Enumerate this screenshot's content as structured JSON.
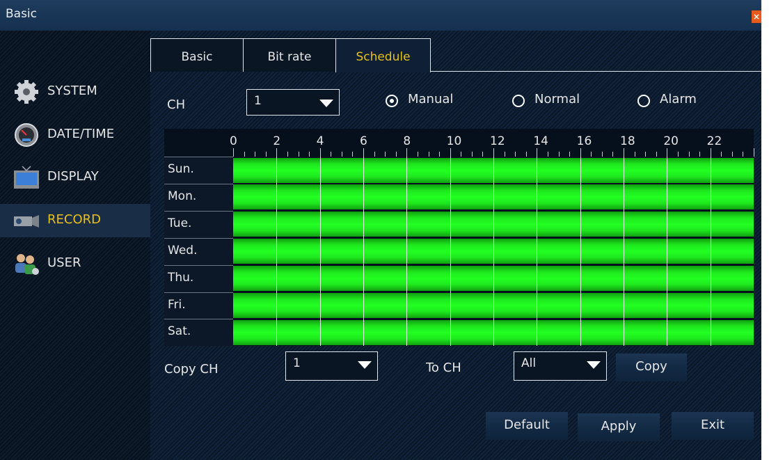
{
  "window": {
    "title": "Basic",
    "close_icon": "×"
  },
  "sidebar": {
    "items": [
      {
        "label": "SYSTEM",
        "icon": "gear-icon",
        "active": false
      },
      {
        "label": "DATE/TIME",
        "icon": "gauge-icon",
        "active": false
      },
      {
        "label": "DISPLAY",
        "icon": "monitor-icon",
        "active": false
      },
      {
        "label": "RECORD",
        "icon": "camera-icon",
        "active": true
      },
      {
        "label": "USER",
        "icon": "users-icon",
        "active": false
      }
    ]
  },
  "tabs": [
    {
      "label": "Basic"
    },
    {
      "label": "Bit rate"
    },
    {
      "label": "Schedule",
      "active": true
    }
  ],
  "channel": {
    "label": "CH",
    "value": "1"
  },
  "record_modes": [
    {
      "label": "Manual",
      "selected": true
    },
    {
      "label": "Normal",
      "selected": false
    },
    {
      "label": "Alarm",
      "selected": false
    }
  ],
  "schedule": {
    "hour_labels": [
      "0",
      "2",
      "4",
      "6",
      "8",
      "10",
      "12",
      "14",
      "16",
      "18",
      "20",
      "22"
    ],
    "days": [
      "Sun.",
      "Mon.",
      "Tue.",
      "Wed.",
      "Thu.",
      "Fri.",
      "Sat."
    ],
    "fill_color": "#22ff22"
  },
  "copy": {
    "label": "Copy CH",
    "value": "1",
    "to_label": "To CH",
    "to_value": "All",
    "button": "Copy"
  },
  "footer": {
    "default": "Default",
    "apply": "Apply",
    "exit": "Exit"
  },
  "colors": {
    "accent": "#e8c01c",
    "background": "#0d1a2a"
  }
}
